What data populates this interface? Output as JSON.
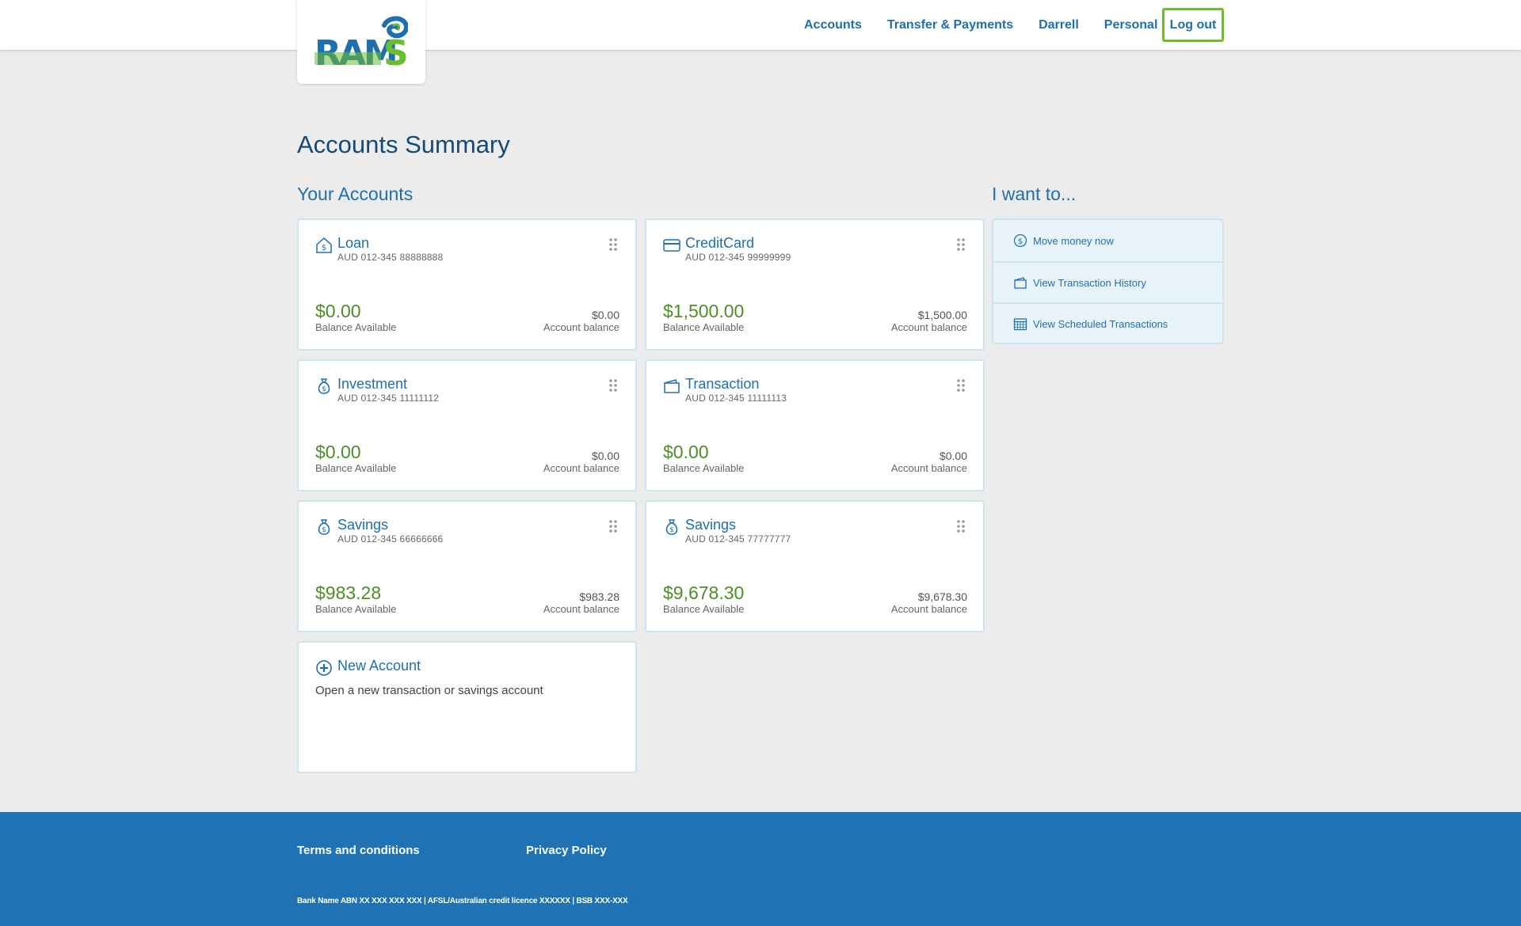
{
  "header": {
    "logo_text": "RAMS",
    "nav": [
      "Accounts",
      "Transfer & Payments",
      "Darrell",
      "Personal"
    ],
    "logout_label": "Log out"
  },
  "page_title": "Accounts Summary",
  "your_accounts": {
    "title": "Your Accounts",
    "accounts": [
      {
        "name": "Loan",
        "number": "AUD  012-345  88888888",
        "balance": "$0.00",
        "balance_label": "Balance Available",
        "account_balance": "$0.00",
        "account_balance_label": "Account balance",
        "icon": "house-dollar-icon"
      },
      {
        "name": "CreditCard",
        "number": "AUD  012-345  99999999",
        "balance": "$1,500.00",
        "balance_label": "Balance Available",
        "account_balance": "$1,500.00",
        "account_balance_label": "Account balance",
        "icon": "credit-card-icon"
      },
      {
        "name": "Investment",
        "number": "AUD  012-345  11111112",
        "balance": "$0.00",
        "balance_label": "Balance Available",
        "account_balance": "$0.00",
        "account_balance_label": "Account balance",
        "icon": "money-bag-icon"
      },
      {
        "name": "Transaction",
        "number": "AUD  012-345  11111113",
        "balance": "$0.00",
        "balance_label": "Balance Available",
        "account_balance": "$0.00",
        "account_balance_label": "Account balance",
        "icon": "wallet-icon"
      },
      {
        "name": "Savings",
        "number": "AUD  012-345  66666666",
        "balance": "$983.28",
        "balance_label": "Balance Available",
        "account_balance": "$983.28",
        "account_balance_label": "Account balance",
        "icon": "money-bag-icon"
      },
      {
        "name": "Savings",
        "number": "AUD  012-345  77777777",
        "balance": "$9,678.30",
        "balance_label": "Balance Available",
        "account_balance": "$9,678.30",
        "account_balance_label": "Account balance",
        "icon": "money-bag-icon"
      }
    ],
    "new_account": {
      "title": "New Account",
      "description": "Open a new transaction or savings account",
      "icon": "plus-circle-icon"
    }
  },
  "i_want_to": {
    "title": "I want to...",
    "items": [
      {
        "label": "Move money now",
        "icon": "dollar-circle-icon"
      },
      {
        "label": "View Transaction History",
        "icon": "wallet-icon"
      },
      {
        "label": "View Scheduled Transactions",
        "icon": "calendar-icon"
      }
    ]
  },
  "footer": {
    "terms": "Terms and conditions",
    "privacy": "Privacy Policy",
    "legal": "Bank Name ABN XX XXX XXX XXX | AFSL/Australian credit licence XXXXXX | BSB XXX-XXX"
  },
  "colors": {
    "brand_blue": "#1e6fb0",
    "balance_green": "#4e8d27",
    "logout_border": "#6cbd2f",
    "footer_bg": "#1f72b3"
  }
}
